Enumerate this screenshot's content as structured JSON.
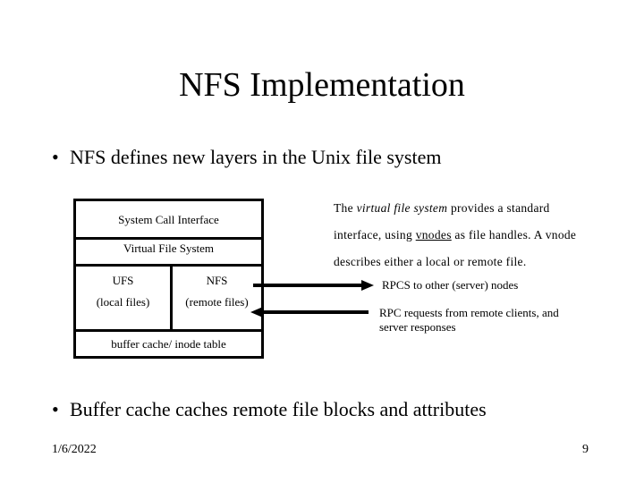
{
  "slide": {
    "title": "NFS Implementation",
    "bullets": [
      "NFS defines new layers in the Unix file system",
      "Buffer cache caches remote file blocks and attributes"
    ],
    "bullet_glyph": "•",
    "diagram": {
      "layers": {
        "syscall": "System Call Interface",
        "vfs": "Virtual File System",
        "ufs_name": "UFS",
        "ufs_desc": "(local files)",
        "nfs_name": "NFS",
        "nfs_desc": "(remote files)",
        "buffer": "buffer cache/ inode table"
      },
      "arrows": {
        "outgoing": "RPCS to other (server) nodes",
        "incoming_line1": "RPC requests from remote clients, and",
        "incoming_line2": "server responses"
      }
    },
    "description": {
      "prefix": "The ",
      "italic": "virtual file system",
      "mid": " provides a standard",
      "line2_prefix": "interface, using ",
      "underlined": "vnodes",
      "line2_suffix": " as file handles.  A vnode",
      "line3": "describes either a local or remote file."
    },
    "footer": {
      "date": "1/6/2022",
      "page": "9"
    }
  }
}
